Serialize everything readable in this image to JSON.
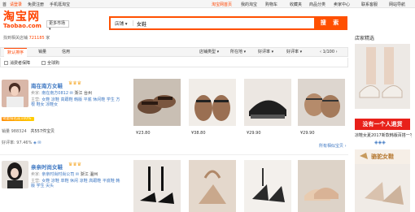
{
  "topbar": {
    "home": "首",
    "login": "请登录",
    "register": "免费注册",
    "mobile": "手机逛淘宝",
    "taobao_home": "淘宝网首页",
    "my_taobao": "我的淘宝",
    "cart": "购物车",
    "favorites": "收藏夹",
    "categories": "商品分类",
    "seller_center": "卖家中心",
    "contact": "联系客服",
    "sitemap": "网站导航",
    "colors": {
      "accent": "#ff5000"
    }
  },
  "logo": {
    "cn": "淘宝网",
    "en": "Taobao.com"
  },
  "site_select": "更多市场",
  "search": {
    "scope": "店铺",
    "query": "女鞋",
    "button": "搜 索",
    "icon": "search-icon"
  },
  "result": {
    "prefix": "找到相关店铺",
    "count": "721185",
    "suffix": "家"
  },
  "sidebar": {
    "title": "店家精选",
    "item1_caption": "凉鞋女夏2017新款韩版百搭一字扣",
    "banner1": "没有一个人退货",
    "banner2": "骆驼女鞋"
  },
  "tabs": {
    "default": "默认排序",
    "sales": "销量",
    "credit": "信用"
  },
  "filters": {
    "consumer_protect": "消费者保障",
    "global": "全球购",
    "shop_type": "店铺类型",
    "location": "所在地",
    "rating": "好评率",
    "good_rate": "好评率",
    "page": "1/100"
  },
  "shops": [
    {
      "name": "南在南方女鞋",
      "seller_label": "卖家:",
      "seller": "南在南方0812",
      "location": "浙江 台州",
      "main_label": "主营:",
      "main": "女鞋 凉鞋 高跟鞋 韩版 平底 休闲鞋 学生 方根 鞋女 凉鞋女",
      "sales_label": "销量",
      "sales": "988324",
      "count_label": "共557件宝贝",
      "rate_label": "好评率",
      "rate": "97.46%",
      "more": "所有相似宝贝",
      "prices": [
        "¥23.80",
        "¥38.80",
        "¥29.90",
        "¥29.90"
      ]
    },
    {
      "name": "亲亲时尚女鞋",
      "seller_label": "卖家:",
      "seller": "亲亲时尚时尚公司",
      "location": "浙江 温州",
      "main_label": "主营:",
      "main": "女鞋 凉鞋 单鞋 休闲 凉鞋 高跟鞋 平底鞋 韩版 学生 尖头"
    }
  ],
  "sales_badge": "销量排名前100%"
}
